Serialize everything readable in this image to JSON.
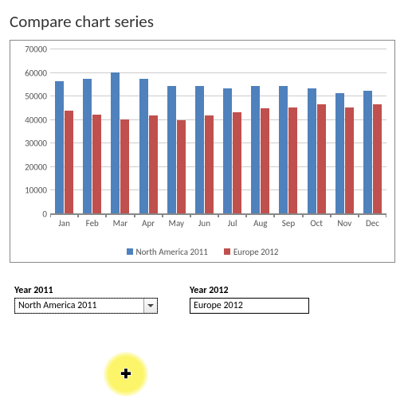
{
  "title": "Compare chart series",
  "chart_data": {
    "type": "bar",
    "title": "",
    "xlabel": "",
    "ylabel": "",
    "ylim": [
      0,
      70000
    ],
    "y_ticks": [
      0,
      10000,
      20000,
      30000,
      40000,
      50000,
      60000,
      70000
    ],
    "categories": [
      "Jan",
      "Feb",
      "Mar",
      "Apr",
      "May",
      "Jun",
      "Jul",
      "Aug",
      "Sep",
      "Oct",
      "Nov",
      "Dec"
    ],
    "series": [
      {
        "name": "North America 2011",
        "color": "#4f81bd",
        "values": [
          56000,
          57000,
          60000,
          57000,
          54000,
          54000,
          53000,
          54000,
          54000,
          53000,
          51000,
          52000
        ]
      },
      {
        "name": "Europe 2012",
        "color": "#c0504d",
        "values": [
          43500,
          42000,
          40000,
          41500,
          39500,
          41500,
          43000,
          44500,
          45000,
          46500,
          45000,
          46500
        ]
      }
    ]
  },
  "controls": {
    "left": {
      "label": "Year 2011",
      "value": "North America 2011"
    },
    "right": {
      "label": "Year 2012",
      "value": "Europe 2012"
    }
  }
}
